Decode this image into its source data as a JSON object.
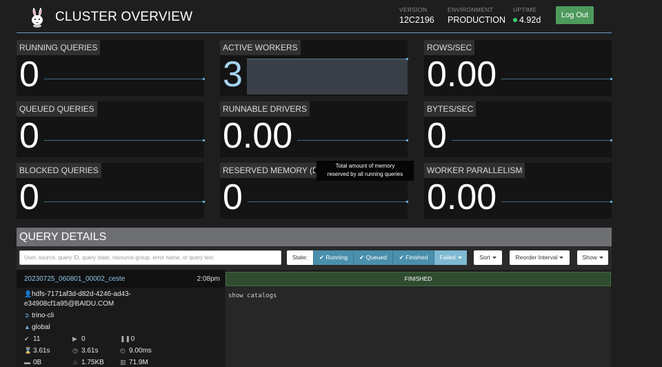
{
  "header": {
    "title": "CLUSTER OVERVIEW",
    "version": {
      "label": "VERSION",
      "value": "12C2196"
    },
    "environment": {
      "label": "ENVIRONMENT",
      "value": "PRODUCTION"
    },
    "uptime": {
      "label": "UPTIME",
      "value": "4.92d"
    },
    "logout_label": "Log Out"
  },
  "tiles": {
    "running_queries": {
      "label": "RUNNING QUERIES",
      "value": "0"
    },
    "active_workers": {
      "label": "ACTIVE WORKERS",
      "value": "3"
    },
    "rows_sec": {
      "label": "ROWS/SEC",
      "value": "0.00"
    },
    "queued_queries": {
      "label": "QUEUED QUERIES",
      "value": "0"
    },
    "runnable_drivers": {
      "label": "RUNNABLE DRIVERS",
      "value": "0.00"
    },
    "bytes_sec": {
      "label": "BYTES/SEC",
      "value": "0"
    },
    "blocked_queries": {
      "label": "BLOCKED QUERIES",
      "value": "0"
    },
    "reserved_memory": {
      "label": "RESERVED MEMORY (B)",
      "value": "0"
    },
    "worker_parallelism": {
      "label": "WORKER PARALLELISM",
      "value": "0.00"
    }
  },
  "tooltip": {
    "line1": "Total amount of memory",
    "line2": "reserved by all running queries"
  },
  "query_details": {
    "title": "QUERY DETAILS",
    "search_placeholder": "User, source, query ID, query state, resource group, error name, or query text",
    "state_label": "State:",
    "filters": [
      {
        "label": "Running",
        "checked": true
      },
      {
        "label": "Queued",
        "checked": true
      },
      {
        "label": "Finished",
        "checked": true
      },
      {
        "label": "Failed",
        "checked": false
      }
    ],
    "sort_label": "Sort",
    "reorder_label": "Reorder Interval",
    "show_label": "Show"
  },
  "query": {
    "id": "20230725_060801_00002_ceste",
    "time": "2:08pm",
    "user_line1": "hdfs-7171af3d-d82d-4246-ad43-",
    "user_line2": "e34908cf1a95@BAIDU.COM",
    "source": "trino-cli",
    "resource_group": "global",
    "completed_splits": "11",
    "running_splits": "0",
    "queued_splits": "0",
    "wall_time": "3.61s",
    "elapsed_time": "3.61s",
    "cpu_time": "9.00ms",
    "memory": "0B",
    "peak_memory": "1.75KB",
    "cumulative": "71.9M",
    "state": "FINISHED",
    "text": "show catalogs"
  }
}
